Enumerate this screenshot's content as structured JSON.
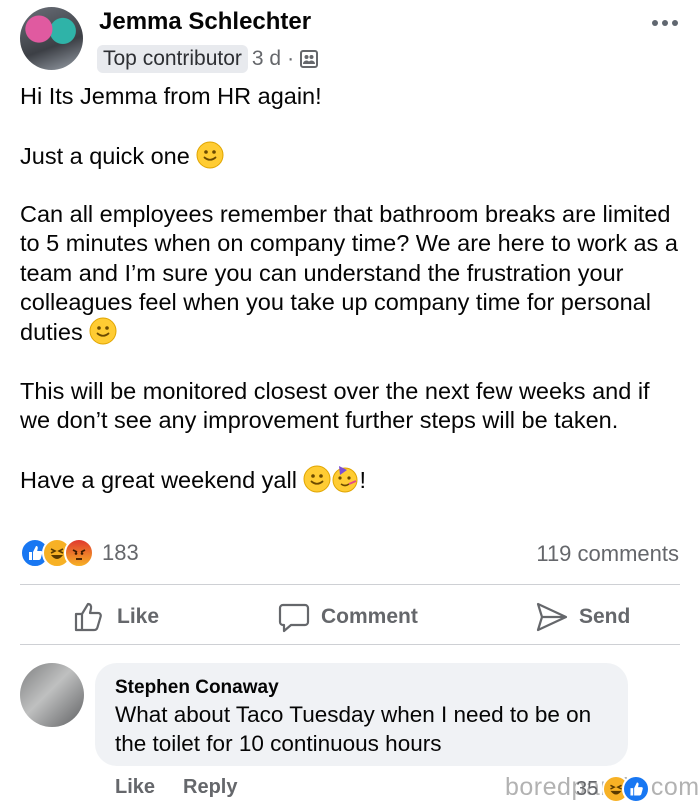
{
  "post": {
    "author": "Jemma Schlechter",
    "badge": "Top contributor",
    "time": "3 d",
    "separator": "·",
    "audience_icon": "friends-icon",
    "lines": {
      "l1": "Hi Its Jemma from HR again!",
      "l2": "Just a quick one",
      "l3": "Can all employees remember that bathroom breaks are limited to 5 minutes when on company time? We are here to work as a team and I’m sure you can understand the frustration your colleagues feel when you take up company time for personal duties",
      "l4": "This will be monitored closest over the next few weeks and if we don’t see any improvement further steps will be taken.",
      "l5": "Have a great weekend yall",
      "l5_end": "!"
    },
    "reaction_count": "183",
    "comment_count": "119 comments"
  },
  "actions": {
    "like": "Like",
    "comment": "Comment",
    "send": "Send"
  },
  "comment": {
    "author": "Stephen Conaway",
    "text": "What about Taco Tuesday when I need to be on the toilet for 10 continuous hours",
    "like": "Like",
    "reply": "Reply",
    "reaction_count": "35"
  },
  "watermark": "boredpanda.com",
  "colors": {
    "like_blue": "#1877f2",
    "haha_yellow": "#f7b125",
    "angry_orange": "#e9710f",
    "muted_text": "#65676b"
  }
}
